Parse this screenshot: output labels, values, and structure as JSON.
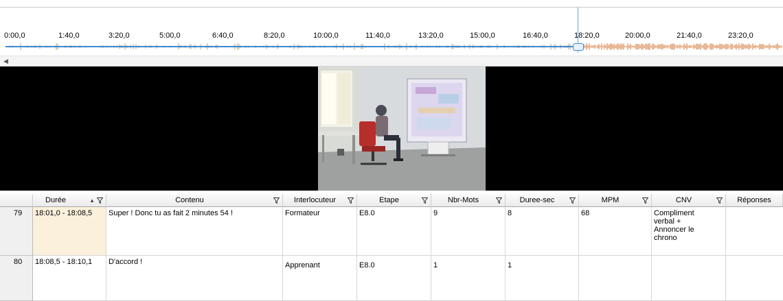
{
  "timeline": {
    "ticks": [
      "0:00,0",
      "1:40,0",
      "3:20,0",
      "5:00,0",
      "6:40,0",
      "8:20,0",
      "10:00,0",
      "11:40,0",
      "13:20,0",
      "15:00,0",
      "16:40,0",
      "18:20,0",
      "20:00,0",
      "21:40,0",
      "23:20,0"
    ],
    "colors": {
      "track": "#3a8ad6",
      "wave_past": "#b9a37a",
      "wave_future": "#d2722e"
    }
  },
  "grid": {
    "columns": [
      "Durée",
      "Contenu",
      "Interlocuteur",
      "Etape",
      "Nbr-Mots",
      "Duree-sec",
      "MPM",
      "CNV",
      "Réponses"
    ],
    "rows": [
      {
        "num": "79",
        "duree": "18:01,0 - 18:08,5",
        "contenu": "Super ! Donc tu as fait 2 minutes 54 !",
        "interlocuteur": "Formateur",
        "etape": "E8.0",
        "nbr_mots": "9",
        "duree_sec": "8",
        "mpm": "68",
        "cnv": "Compliment verbal + Annoncer le chrono",
        "reponses": ""
      },
      {
        "num": "80",
        "duree": "18:08,5 - 18:10,1",
        "contenu": "D'accord !",
        "interlocuteur": "Apprenant",
        "etape": "E8.0",
        "nbr_mots": "1",
        "duree_sec": "1",
        "mpm": "",
        "cnv": "",
        "reponses": ""
      }
    ]
  }
}
